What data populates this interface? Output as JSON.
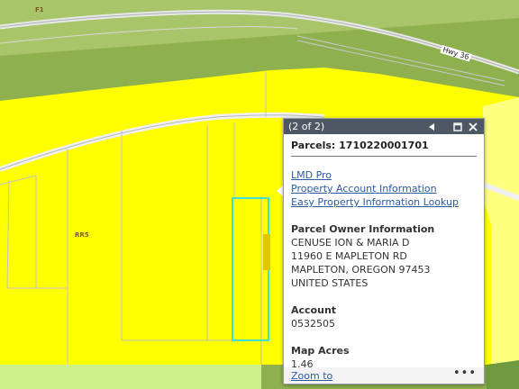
{
  "map": {
    "zone_labels": [
      {
        "id": "f1",
        "text": "F1"
      },
      {
        "id": "rr5",
        "text": "RR5"
      }
    ],
    "road_label": "Hwy 36",
    "colors": {
      "forest": "#8fb04f",
      "rural_residential": "#ffff00",
      "pale_yellow": "#ffff80",
      "selection": "#40e0d0",
      "lines": "#c0c0c0"
    }
  },
  "popup": {
    "counter": "(2 of 2)",
    "prev_icon": "triangle-left-icon",
    "maximize_icon": "maximize-icon",
    "close_icon": "close-icon",
    "title": "Parcels: 1710220001701",
    "links": [
      "LMD Pro",
      "Property Account Information",
      "Easy Property Information Lookup"
    ],
    "owner_heading": "Parcel Owner Information",
    "owner_lines": [
      "CENUSE ION & MARIA D",
      "11960 E MAPLETON RD",
      "MAPLETON, OREGON 97453",
      "UNITED STATES"
    ],
    "account_heading": "Account",
    "account_value": "0532505",
    "acres_heading": "Map Acres",
    "acres_value": "1.46",
    "zoom_link": "Zoom to",
    "more_icon": "more-options-icon"
  }
}
